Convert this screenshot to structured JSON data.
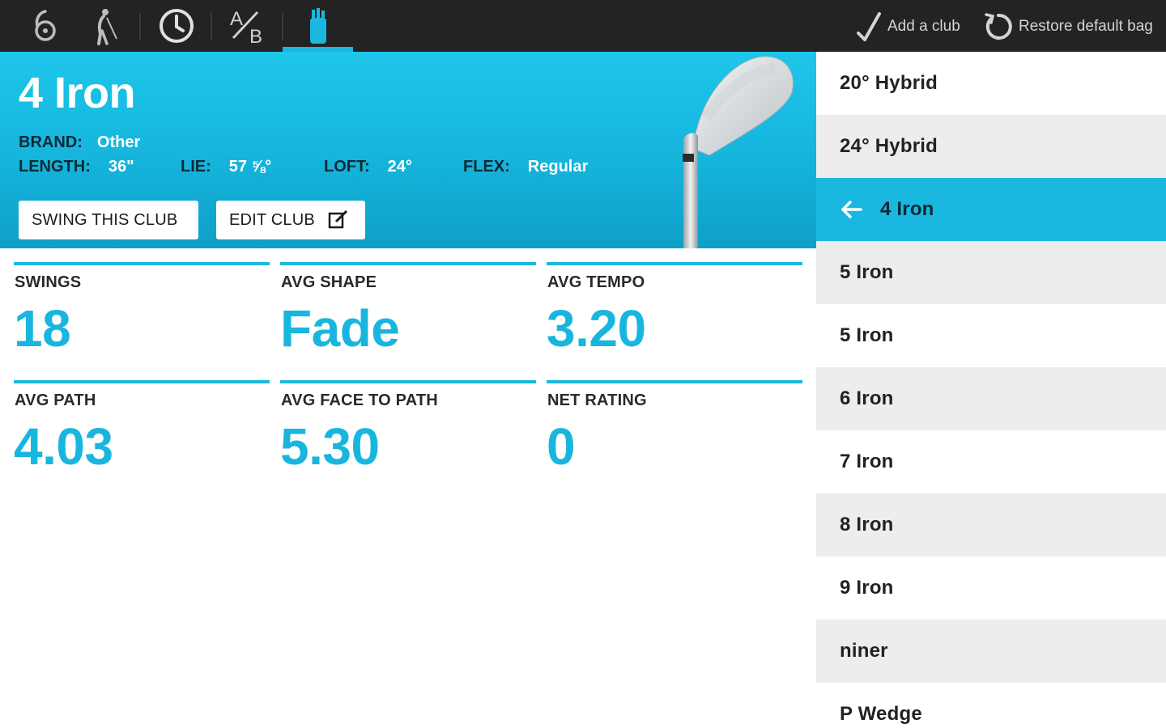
{
  "topbar": {
    "nav_icons": [
      "swing-icon",
      "golfer-icon",
      "clock-icon",
      "ab-compare-icon",
      "golf-bag-icon"
    ],
    "actions": {
      "add_club": "Add a club",
      "restore_bag": "Restore default bag"
    },
    "accent_color": "#1ab8e0"
  },
  "club": {
    "name": "4 Iron",
    "brand_label": "BRAND:",
    "brand": "Other",
    "length_label": "LENGTH:",
    "length": "36\"",
    "lie_label": "LIE:",
    "lie": "57 ⅝°",
    "loft_label": "LOFT:",
    "loft": "24°",
    "flex_label": "FLEX:",
    "flex": "Regular",
    "swing_button": "SWING THIS CLUB",
    "edit_button": "EDIT CLUB"
  },
  "stats": [
    {
      "label": "SWINGS",
      "value": "18"
    },
    {
      "label": "AVG SHAPE",
      "value": "Fade"
    },
    {
      "label": "AVG TEMPO",
      "value": "3.20"
    },
    {
      "label": "AVG PATH",
      "value": "4.03"
    },
    {
      "label": "AVG FACE TO PATH",
      "value": "5.30"
    },
    {
      "label": "NET RATING",
      "value": "0"
    }
  ],
  "club_list": [
    {
      "label": "20° Hybrid"
    },
    {
      "label": "24° Hybrid"
    },
    {
      "label": "4 Iron",
      "selected": true
    },
    {
      "label": "5 Iron"
    },
    {
      "label": "5 Iron"
    },
    {
      "label": "6 Iron"
    },
    {
      "label": "7 Iron"
    },
    {
      "label": "8 Iron"
    },
    {
      "label": "9 Iron"
    },
    {
      "label": "niner"
    },
    {
      "label": "P Wedge"
    }
  ]
}
